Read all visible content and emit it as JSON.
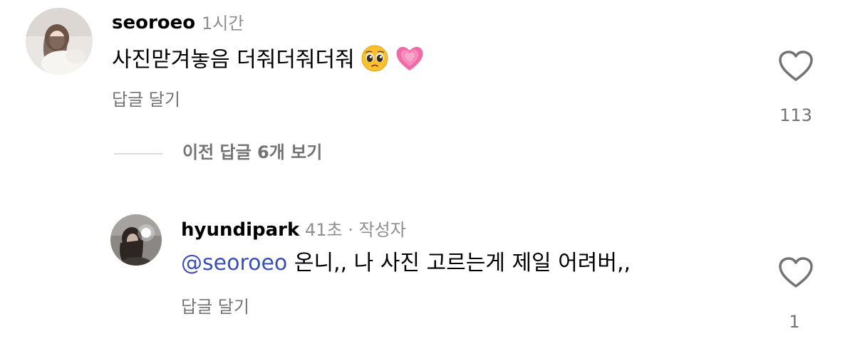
{
  "comments": [
    {
      "username": "seoroeo",
      "time": "1시간",
      "text": "사진맏겨놓음 더줘더줘더줘",
      "emojis": [
        "pleading-face",
        "growing-heart"
      ],
      "reply_label": "답글 달기",
      "like_count": "113"
    }
  ],
  "view_previous_replies": "이전 답글 6개 보기",
  "replies": [
    {
      "username": "hyundipark",
      "time": "41초",
      "separator": "·",
      "author_badge": "작성자",
      "mention": "@seoroeo",
      "text": "온니,, 나 사진 고르는게 제일 어려버,,",
      "reply_label": "답글 달기",
      "like_count": "1"
    }
  ],
  "colors": {
    "mention": "#3b4fb8",
    "secondary_text": "#737373",
    "meta_text": "#8e8e8e",
    "divider": "#dbdbdb"
  }
}
